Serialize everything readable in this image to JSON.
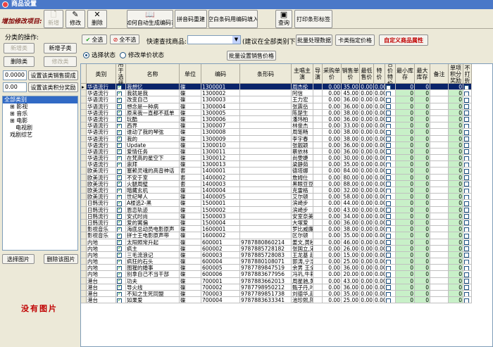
{
  "window": {
    "title": "商品设置"
  },
  "toolbar": {
    "caption": "增加修改项目:",
    "new": "新增",
    "edit": "修改",
    "delete": "删除",
    "auto_code": "如何自动生成编码?",
    "pinyin": "拼音码重建",
    "fill_blank": "空白条码用编码填入",
    "query": "查询",
    "print_barcode": "打印条形标签"
  },
  "left": {
    "category_ops": "分类的操作:",
    "new_major": "新增类",
    "new_sub": "新增子类",
    "delete_cat": "删除类",
    "edit_cat": "修改类",
    "commission_value": "0.0000",
    "commission_btn": "设置该类销售提成",
    "points_value": "0.00",
    "points_btn": "设置该类积分奖励",
    "tree": [
      {
        "label": "全部类别",
        "indent": 0,
        "selected": true
      },
      {
        "label": "影视",
        "indent": 1,
        "prefix": "⊞"
      },
      {
        "label": "音乐",
        "indent": 1,
        "prefix": "⊞"
      },
      {
        "label": "电影",
        "indent": 1,
        "prefix": "⊞"
      },
      {
        "label": "电视剧",
        "indent": 2
      },
      {
        "label": "戏剧综艺",
        "indent": 1
      }
    ],
    "choose_pic": "选择图片",
    "delete_pic": "删除该图片",
    "no_pic": "没有图片"
  },
  "options": {
    "select_all": "全选",
    "select_none": "全不选",
    "search_label": "快速查找商品:",
    "search_hint": "(建议在全部类别下)",
    "batch_process": "批量处理数据",
    "card_price": "卡类指定价格",
    "custom_attr": "自定义商品属性",
    "radio_select": "选择状态",
    "radio_price": "修改单价状态",
    "batch_price": "批量设置销售价格"
  },
  "grid": {
    "headers": [
      "",
      "类别",
      "用于选择",
      "名称",
      "单位",
      "编码",
      "条形码",
      "主唱主演",
      "导演",
      "采购单价",
      "销售单价",
      "最低售价",
      "特价",
      "合价特价",
      "最小库存",
      "最大库存",
      "备注",
      "单项积分奖励",
      "不打折"
    ],
    "rows": [
      [
        "华语流行",
        "我想忆",
        "碟",
        "1300001",
        "",
        "周杰伦",
        "",
        "0.00",
        "35.00",
        "0.00",
        "0.00",
        "0",
        "0",
        "0"
      ],
      [
        "华语流行",
        "我就是我",
        "碟",
        "1300002",
        "",
        "阿信",
        "",
        "0.00",
        "45.00",
        "0.00",
        "0.00",
        "0",
        "0",
        "0"
      ],
      [
        "华语流行",
        "改变自己",
        "碟",
        "1300003",
        "",
        "王力宏",
        "",
        "0.00",
        "36.00",
        "0.00",
        "0.00",
        "0",
        "0",
        "0"
      ],
      [
        "华语流行",
        "想念是一种病",
        "碟",
        "1300004",
        "",
        "张震岳",
        "",
        "0.00",
        "36.00",
        "0.00",
        "0.00",
        "0",
        "0",
        "0"
      ],
      [
        "华语流行",
        "原来我一直都不孤单",
        "碟",
        "1300005",
        "",
        "陈楚生",
        "",
        "0.00",
        "38.00",
        "0.00",
        "0.00",
        "0",
        "0",
        "0"
      ],
      [
        "华语流行",
        "玩酷",
        "碟",
        "1300006",
        "",
        "潘玮柏",
        "",
        "0.00",
        "36.00",
        "0.00",
        "0.00",
        "0",
        "0",
        "0"
      ],
      [
        "华语流行",
        "西界",
        "碟",
        "1300007",
        "",
        "林俊杰",
        "",
        "0.00",
        "33.00",
        "0.00",
        "0.00",
        "0",
        "0",
        "0"
      ],
      [
        "华语流行",
        "谁动了我的琴弦",
        "碟",
        "1300008",
        "",
        "周笔畅",
        "",
        "0.00",
        "38.00",
        "0.00",
        "0.00",
        "0",
        "0",
        "0"
      ],
      [
        "华语流行",
        "我的",
        "碟",
        "1300009",
        "",
        "李宇春",
        "",
        "0.00",
        "38.00",
        "0.00",
        "0.00",
        "0",
        "0",
        "0"
      ],
      [
        "华语流行",
        "Update",
        "碟",
        "1300010",
        "",
        "张靓颖",
        "",
        "0.00",
        "36.00",
        "0.00",
        "0.00",
        "0",
        "0",
        "0"
      ],
      [
        "华语流行",
        "爱情任务",
        "碟",
        "1300011",
        "",
        "蔡依林",
        "",
        "0.00",
        "36.00",
        "0.00",
        "0.00",
        "0",
        "0",
        "0"
      ],
      [
        "华语流行",
        "在梵高的星空下",
        "碟",
        "1300012",
        "",
        "尚雯婕",
        "",
        "0.00",
        "30.00",
        "0.00",
        "0.00",
        "0",
        "0",
        "0"
      ],
      [
        "华语流行",
        "崇拜",
        "碟",
        "1300013",
        "",
        "梁静茹",
        "",
        "0.00",
        "35.00",
        "0.00",
        "0.00",
        "0",
        "0",
        "0"
      ],
      [
        "欧美流行",
        "塞赖灵魂的高音神话",
        "套",
        "1400001",
        "",
        "德塔娜",
        "",
        "0.00",
        "84.00",
        "0.00",
        "0.00",
        "0",
        "0",
        "0"
      ],
      [
        "欧美流行",
        "不安于室",
        "套",
        "1400002",
        "",
        "詹姆仕",
        "",
        "0.00",
        "80.00",
        "0.00",
        "0.00",
        "0",
        "0",
        "0"
      ],
      [
        "欧美流行",
        "火腿周璧",
        "套",
        "1400003",
        "",
        "黑眼豆豆",
        "",
        "0.00",
        "88.00",
        "0.00",
        "0.00",
        "0",
        "0",
        "0"
      ],
      [
        "欧美流行",
        "暗藏玄机",
        "碟",
        "1400004",
        "",
        "克雷格",
        "",
        "0.00",
        "32.00",
        "0.00",
        "0.00",
        "0",
        "0",
        "0"
      ],
      [
        "欧美流行",
        "世纪琴人",
        "碟",
        "1400005",
        "",
        "艾尔顿",
        "",
        "0.00",
        "58.00",
        "0.00",
        "0.00",
        "0",
        "0",
        "0"
      ],
      [
        "日韩流行",
        "A楼选2-黑",
        "碟",
        "1500001",
        "",
        "滨崎步",
        "",
        "0.00",
        "44.00",
        "0.00",
        "0.00",
        "0",
        "0",
        "0"
      ],
      [
        "日韩流行",
        "恩恋轨迹",
        "碟",
        "1500002",
        "",
        "滨崎步",
        "",
        "0.00",
        "43.00",
        "0.00",
        "0.00",
        "0",
        "0",
        "0"
      ],
      [
        "日韩流行",
        "安式时尚",
        "碟",
        "1500003",
        "",
        "安室奈美",
        "",
        "0.00",
        "34.00",
        "0.00",
        "0.00",
        "0",
        "0",
        "0"
      ],
      [
        "日韩流行",
        "爱的寓偏",
        "碟",
        "1500004",
        "",
        "大塚爱",
        "",
        "0.00",
        "36.00",
        "0.00",
        "0.00",
        "0",
        "0",
        "0"
      ],
      [
        "影视音乐",
        "海底总动员电影原声",
        "碟",
        "1600001",
        "",
        "罗比威廉",
        "",
        "0.00",
        "38.00",
        "0.00",
        "0.00",
        "0",
        "0",
        "0"
      ],
      [
        "影视音乐",
        "拼士王电影原声带",
        "碟",
        "1600002",
        "",
        "区尔顿",
        "",
        "0.00",
        "35.00",
        "0.00",
        "0.00",
        "0",
        "0",
        "0"
      ],
      [
        "内地",
        "太阳照常升起",
        "碟",
        "600001",
        "9787880860214",
        "姜文,黄秋生",
        "",
        "0.00",
        "46.00",
        "0.00",
        "0.00",
        "0",
        "0",
        "0"
      ],
      [
        "内地",
        "疯主",
        "碟",
        "600002",
        "9787885728182",
        "张国立,宋春",
        "",
        "0.00",
        "26.00",
        "0.00",
        "0.00",
        "0",
        "0",
        "0"
      ],
      [
        "内地",
        "三毛流浪记",
        "碟",
        "600003",
        "9787885728083",
        "王龙基 赵明",
        "",
        "0.00",
        "15.00",
        "0.00",
        "0.00",
        "0",
        "0",
        "0"
      ],
      [
        "内地",
        "疯狂的石头",
        "碟",
        "600004",
        "9787880108071",
        "郭涛,宁浩",
        "",
        "0.00",
        "25.00",
        "0.00",
        "0.00",
        "0",
        "0",
        "0"
      ],
      [
        "内地",
        "图猩的婚事",
        "碟",
        "600005",
        "9787789847519",
        "余男 王全",
        "",
        "0.00",
        "36.00",
        "0.00",
        "0.00",
        "0",
        "0",
        "0"
      ],
      [
        "内地",
        "别拿自己不当干部",
        "碟",
        "600006",
        "9787883677956",
        "冯巩,牛莉",
        "",
        "0.00",
        "20.00",
        "0.00",
        "0.00",
        "0",
        "0",
        "0"
      ],
      [
        "港台",
        "功夫",
        "碟",
        "700001",
        "9787883662013",
        "周星驰,黄",
        "",
        "0.00",
        "43.00",
        "0.00",
        "0.00",
        "0",
        "0",
        "0"
      ],
      [
        "港台",
        "导火线",
        "碟",
        "700002",
        "9787798950212",
        "甄子丹,叶",
        "",
        "0.00",
        "36.00",
        "0.00",
        "0.00",
        "0",
        "0",
        "0"
      ],
      [
        "港台",
        "不知之生死同盟",
        "碟",
        "700003",
        "9787789851738",
        "刘德华,赵",
        "",
        "0.00",
        "35.00",
        "0.00",
        "0.00",
        "0",
        "0",
        "0"
      ],
      [
        "港台",
        "如果爱",
        "碟",
        "700004",
        "9787883633341",
        "池珍熙,陈",
        "",
        "0.00",
        "25.00",
        "0.00",
        "0.00",
        "0",
        "0",
        "0"
      ]
    ]
  }
}
